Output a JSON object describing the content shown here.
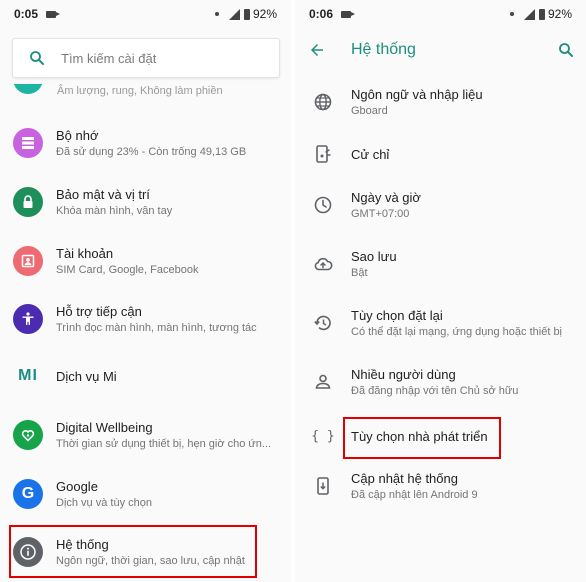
{
  "left": {
    "status": {
      "time": "0:05",
      "battery": "92%"
    },
    "search": {
      "placeholder": "Tìm kiếm cài đặt"
    },
    "partial_item": {
      "sub": "Âm lượng, rung, Không làm phiền"
    },
    "items": [
      {
        "title": "Bộ nhớ",
        "sub": "Đã sử dụng 23% - Còn trống 49,13 GB",
        "icon": "storage-icon",
        "color": "#c862e0"
      },
      {
        "title": "Bảo mật và vị trí",
        "sub": "Khóa màn hình, vân tay",
        "icon": "lock-icon",
        "color": "#1e8e5a"
      },
      {
        "title": "Tài khoản",
        "sub": "SIM Card, Google, Facebook",
        "icon": "account-icon",
        "color": "#ef6b73"
      },
      {
        "title": "Hỗ trợ tiếp cận",
        "sub": "Trình đọc màn hình, màn hình, tương tác",
        "icon": "accessibility-icon",
        "color": "#4b2bb0"
      },
      {
        "title": "Dịch vụ Mi",
        "sub": "",
        "icon": "mi-icon",
        "color": "#1b8f86"
      },
      {
        "title": "Digital Wellbeing",
        "sub": "Thời gian sử dụng thiết bị, hẹn giờ cho ứn...",
        "icon": "wellbeing-icon",
        "color": "#16a34a"
      },
      {
        "title": "Google",
        "sub": "Dịch vụ và tùy chọn",
        "icon": "google-icon",
        "color": "#1a73e8"
      },
      {
        "title": "Hệ thống",
        "sub": "Ngôn ngữ, thời gian, sao lưu, cập nhật",
        "icon": "info-icon",
        "color": "#5f6368"
      }
    ]
  },
  "right": {
    "status": {
      "time": "0:06",
      "battery": "92%"
    },
    "toolbar": {
      "title": "Hệ thống"
    },
    "items": [
      {
        "title": "Ngôn ngữ và nhập liệu",
        "sub": "Gboard",
        "icon": "globe-icon"
      },
      {
        "title": "Cử chỉ",
        "sub": "",
        "icon": "gesture-phone-icon"
      },
      {
        "title": "Ngày và giờ",
        "sub": "GMT+07:00",
        "icon": "clock-icon"
      },
      {
        "title": "Sao lưu",
        "sub": "Bật",
        "icon": "cloud-upload-icon"
      },
      {
        "title": "Tùy chọn đặt lại",
        "sub": "Có thể đặt lại mạng, ứng dụng hoặc thiết bị",
        "icon": "history-icon"
      },
      {
        "title": "Nhiều người dùng",
        "sub": "Đã đăng nhập với tên Chủ sở hữu",
        "icon": "person-icon"
      },
      {
        "title": "Tùy chọn nhà phát triển",
        "sub": "",
        "icon": "braces-icon"
      },
      {
        "title": "Cập nhật hệ thống",
        "sub": "Đã cập nhật lên Android 9",
        "icon": "system-update-icon"
      }
    ]
  }
}
